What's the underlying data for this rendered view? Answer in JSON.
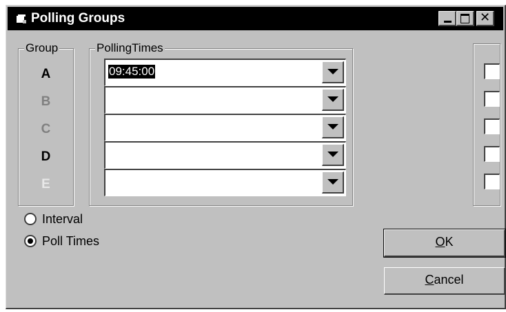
{
  "window": {
    "title": "Polling Groups"
  },
  "group_box": {
    "label": "Group",
    "letters": [
      {
        "text": "A",
        "color": "#000000"
      },
      {
        "text": "B",
        "color": "#808080"
      },
      {
        "text": "C",
        "color": "#808080"
      },
      {
        "text": "D",
        "color": "#000000"
      },
      {
        "text": "E",
        "color": "#e8e8e8"
      }
    ]
  },
  "polling_box": {
    "label": "PollingTimes",
    "combos": [
      {
        "value": "09:45:00"
      },
      {
        "value": ""
      },
      {
        "value": ""
      },
      {
        "value": ""
      },
      {
        "value": ""
      }
    ]
  },
  "checkboxes": [
    false,
    false,
    false,
    false,
    false
  ],
  "mode": {
    "options": [
      {
        "label": "Interval",
        "checked": false
      },
      {
        "label": "Poll Times",
        "checked": true
      }
    ]
  },
  "buttons": {
    "ok": {
      "mnemonic": "O",
      "rest": "K"
    },
    "cancel": {
      "mnemonic": "C",
      "rest": "ancel"
    }
  }
}
